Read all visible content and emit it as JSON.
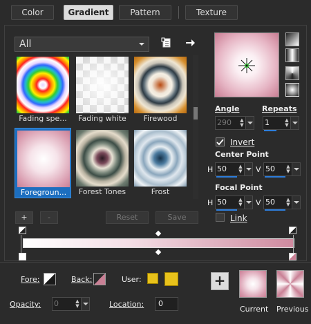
{
  "tabs": [
    {
      "label": "Color",
      "active": false
    },
    {
      "label": "Gradient",
      "active": true
    },
    {
      "label": "Pattern",
      "active": false
    },
    {
      "label": "Texture",
      "active": false
    }
  ],
  "preset_dropdown": {
    "value": "All"
  },
  "presets": [
    {
      "label": "Fading spe...",
      "selected": false
    },
    {
      "label": "Fading white",
      "selected": false
    },
    {
      "label": "Firewood",
      "selected": false
    },
    {
      "label": "Foregroun...",
      "selected": true
    },
    {
      "label": "Forest Tones",
      "selected": false
    },
    {
      "label": "Frost",
      "selected": false
    }
  ],
  "preset_buttons": {
    "add": "+",
    "remove": "-",
    "reset": "Reset",
    "save": "Save"
  },
  "angle": {
    "label": "Angle",
    "value": "290",
    "enabled": false
  },
  "repeats": {
    "label": "Repeats",
    "value": "1"
  },
  "invert": {
    "label": "Invert",
    "checked": true
  },
  "center_point": {
    "label": "Center Point",
    "h_label": "H",
    "h": "50",
    "v_label": "V",
    "v": "50"
  },
  "focal_point": {
    "label": "Focal Point",
    "h_label": "H",
    "h": "50",
    "v_label": "V",
    "v": "50"
  },
  "link": {
    "label": "Link",
    "checked": false
  },
  "stops": {
    "fore_label": "Fore:",
    "back_label": "Back:",
    "user_label": "User:",
    "opacity_label": "Opacity:",
    "opacity_value": "0",
    "location_label": "Location:",
    "location_value": "0"
  },
  "bottom": {
    "add_label": "+",
    "current_label": "Current",
    "previous_label": "Previous"
  },
  "colors": {
    "accent": "#1c6ebf",
    "gradient_start": "#ffffff",
    "gradient_end": "#cf8a9f",
    "user": "#e8c21b"
  }
}
